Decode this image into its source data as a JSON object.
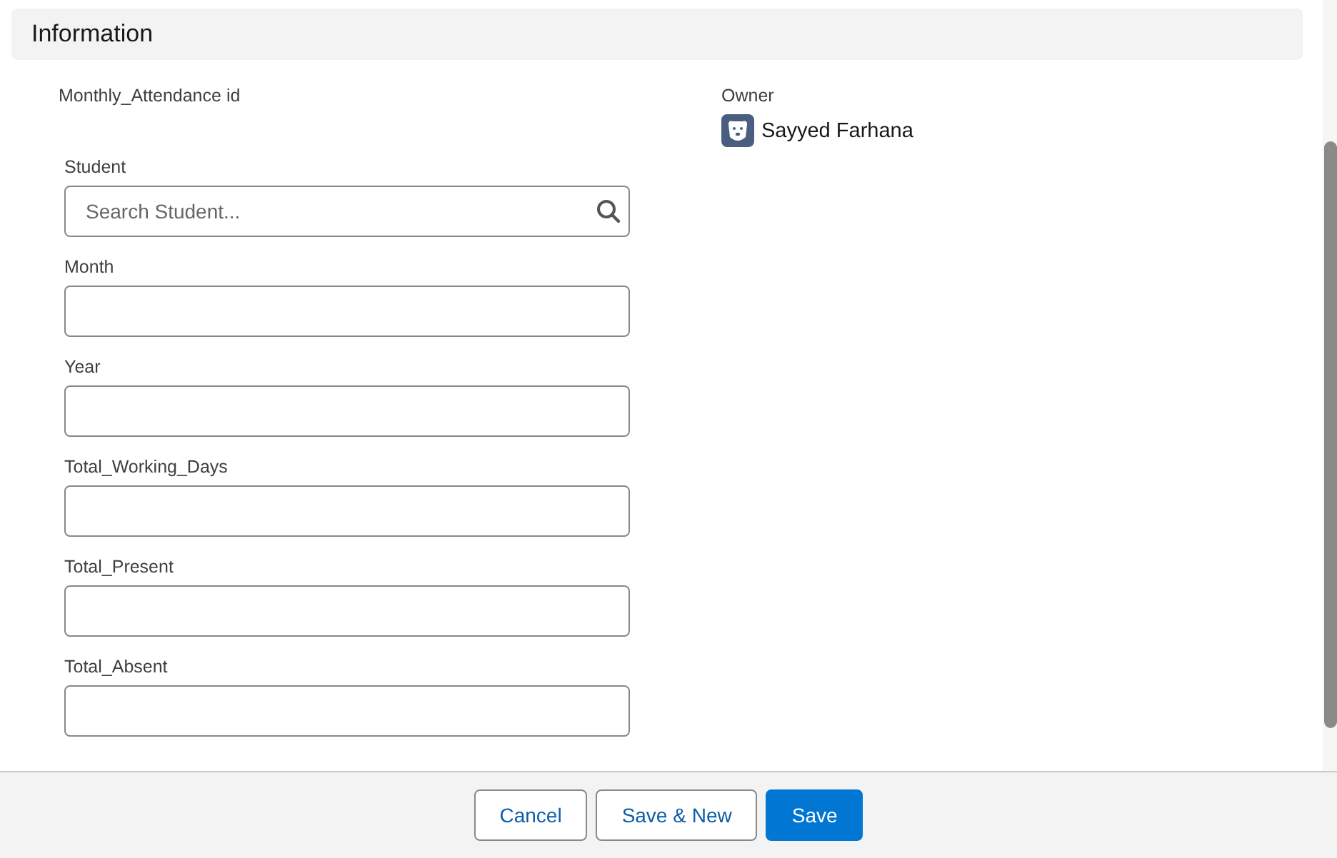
{
  "section": {
    "title": "Information"
  },
  "record_id": {
    "label": "Monthly_Attendance id"
  },
  "owner": {
    "label": "Owner",
    "name": "Sayyed Farhana"
  },
  "fields": [
    {
      "label": "Student",
      "kind": "lookup",
      "placeholder": "Search Student..."
    },
    {
      "label": "Month",
      "kind": "text"
    },
    {
      "label": "Year",
      "kind": "text"
    },
    {
      "label": "Total_Working_Days",
      "kind": "text"
    },
    {
      "label": "Total_Present",
      "kind": "text"
    },
    {
      "label": "Total_Absent",
      "kind": "text"
    }
  ],
  "buttons": [
    {
      "label": "Cancel",
      "kind": "neutral"
    },
    {
      "label": "Save & New",
      "kind": "neutral"
    },
    {
      "label": "Save",
      "kind": "brand"
    }
  ]
}
